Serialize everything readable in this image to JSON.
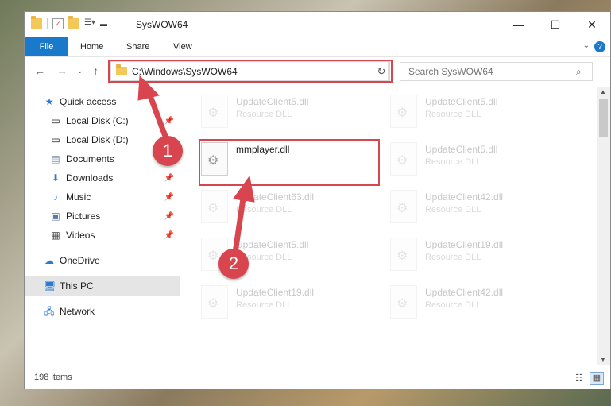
{
  "window": {
    "title": "SysWOW64",
    "controls": {
      "minimize": "—",
      "maximize": "☐",
      "close": "✕"
    }
  },
  "ribbon": {
    "tabs": [
      {
        "label": "File",
        "active": true
      },
      {
        "label": "Home"
      },
      {
        "label": "Share"
      },
      {
        "label": "View"
      }
    ],
    "help_label": "?"
  },
  "nav": {
    "address": "C:\\Windows\\SysWOW64",
    "search_placeholder": "Search SysWOW64"
  },
  "sidebar": {
    "items": [
      {
        "label": "Quick access",
        "icon": "star-icon",
        "pinned": false
      },
      {
        "label": "Local Disk (C:)",
        "icon": "drive-icon",
        "pinned": true
      },
      {
        "label": "Local Disk (D:)",
        "icon": "drive-icon",
        "pinned": false
      },
      {
        "label": "Documents",
        "icon": "documents-icon",
        "pinned": false
      },
      {
        "label": "Downloads",
        "icon": "download-icon",
        "pinned": true
      },
      {
        "label": "Music",
        "icon": "music-icon",
        "pinned": true
      },
      {
        "label": "Pictures",
        "icon": "pictures-icon",
        "pinned": true
      },
      {
        "label": "Videos",
        "icon": "videos-icon",
        "pinned": true
      },
      {
        "label": "OneDrive",
        "icon": "cloud-icon",
        "pinned": false
      },
      {
        "label": "This PC",
        "icon": "computer-icon",
        "selected": true
      },
      {
        "label": "Network",
        "icon": "network-icon",
        "pinned": false
      }
    ]
  },
  "files": [
    {
      "name": "UpdateClient5.dll",
      "type": "Resource DLL",
      "faded": true
    },
    {
      "name": "UpdateClient5.dll",
      "type": "Resource DLL",
      "faded": true
    },
    {
      "name": "mmplayer.dll",
      "type": "",
      "faded": false,
      "highlighted": true
    },
    {
      "name": "UpdateClient5.dll",
      "type": "Resource DLL",
      "faded": true
    },
    {
      "name": "UpdateClient63.dll",
      "type": "Resource DLL",
      "faded": true
    },
    {
      "name": "UpdateClient42.dll",
      "type": "Resource DLL",
      "faded": true
    },
    {
      "name": "UpdateClient5.dll",
      "type": "Resource DLL",
      "faded": true
    },
    {
      "name": "UpdateClient19.dll",
      "type": "Resource DLL",
      "faded": true
    },
    {
      "name": "UpdateClient19.dll",
      "type": "Resource DLL",
      "faded": true
    },
    {
      "name": "UpdateClient42.dll",
      "type": "Resource DLL",
      "faded": true
    }
  ],
  "status": {
    "item_count": "198 items"
  },
  "callouts": [
    {
      "number": "1",
      "color": "#d9454e"
    },
    {
      "number": "2",
      "color": "#d9454e"
    }
  ]
}
